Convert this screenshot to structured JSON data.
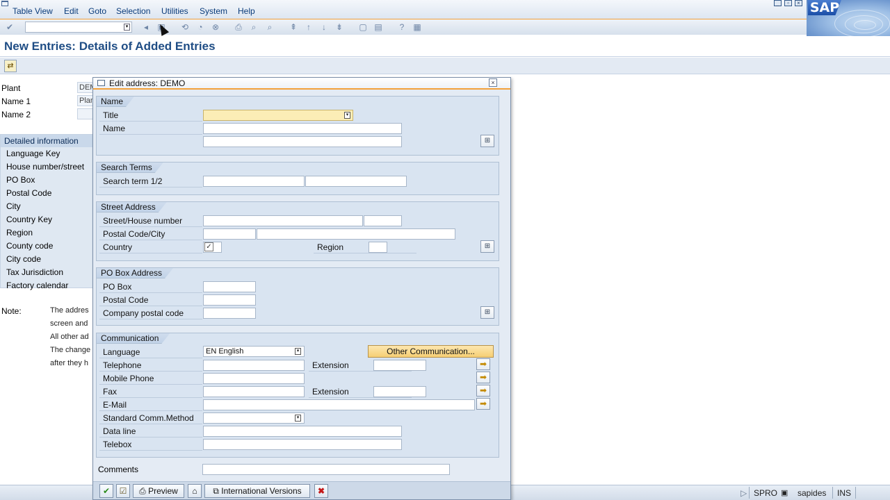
{
  "menubar": {
    "items": [
      "Table View",
      "Edit",
      "Goto",
      "Selection",
      "Utilities",
      "System",
      "Help"
    ]
  },
  "logo": {
    "text": "SAP"
  },
  "title": "New Entries: Details of Added Entries",
  "background": {
    "plant_label": "Plant",
    "plant_value": "DEMO",
    "name1_label": "Name 1",
    "name1_value": "Plant",
    "name2_label": "Name 2",
    "detail_header": "Detailed information",
    "detail_fields": [
      "Language Key",
      "House number/street",
      "PO Box",
      "Postal Code",
      "City",
      "Country Key",
      "Region",
      "County code",
      "City code",
      "Tax Jurisdiction",
      "Factory calendar"
    ],
    "note_label": "Note:",
    "note_lines": [
      "The addres",
      "screen and",
      "All other ad",
      "The change",
      "after they h"
    ]
  },
  "statusbar": {
    "transaction": "SPRO",
    "user": "sapides",
    "mode": "INS"
  },
  "dialog": {
    "title": "Edit address:  DEMO",
    "name_group": {
      "header": "Name",
      "title_label": "Title",
      "name_label": "Name"
    },
    "search_group": {
      "header": "Search Terms",
      "search_label": "Search term 1/2"
    },
    "street_group": {
      "header": "Street Address",
      "street_label": "Street/House number",
      "postal_city_label": "Postal Code/City",
      "country_label": "Country",
      "region_label": "Region"
    },
    "pobox_group": {
      "header": "PO Box Address",
      "pobox_label": "PO Box",
      "postal_label": "Postal Code",
      "company_postal_label": "Company postal code"
    },
    "comm_group": {
      "header": "Communication",
      "language_label": "Language",
      "language_value": "EN English",
      "other_comm_button": "Other Communication...",
      "telephone_label": "Telephone",
      "extension_label": "Extension",
      "mobile_label": "Mobile Phone",
      "fax_label": "Fax",
      "fax_extension_label": "Extension",
      "email_label": "E-Mail",
      "std_comm_label": "Standard Comm.Method",
      "dataline_label": "Data line",
      "telebox_label": "Telebox"
    },
    "comments_label": "Comments",
    "footer": {
      "preview_label": "Preview",
      "intl_versions_label": "International Versions"
    }
  },
  "colors": {
    "accent": "#f3a13a",
    "title_blue": "#1f4d85",
    "required_field": "#fbedb6"
  }
}
